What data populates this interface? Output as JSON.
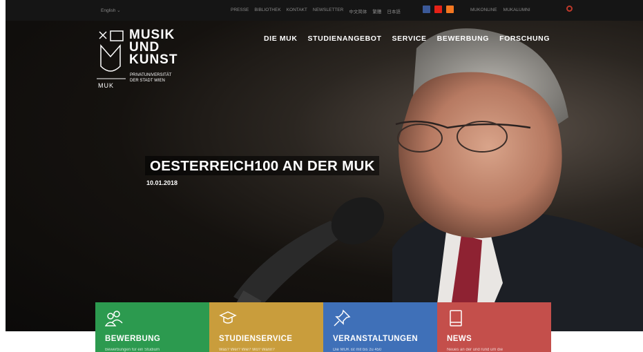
{
  "topbar": {
    "language": "English ⌄",
    "links": [
      "PRESSE",
      "BIBLIOTHEK",
      "KONTAKT",
      "NEWSLETTER",
      "中文简体",
      "繁體",
      "日本語"
    ],
    "social": [
      {
        "icon": "facebook-icon",
        "color": "#3b5998"
      },
      {
        "icon": "youtube-icon",
        "color": "#e62117"
      },
      {
        "icon": "blog-icon",
        "color": "#f47721"
      }
    ],
    "extra_links": [
      "MUKONLINE",
      "MUKALUMNI"
    ]
  },
  "logo": {
    "lines": [
      "MUSIK",
      "UND",
      "KUNST"
    ],
    "subtitle": [
      "PRIVATUNIVERSITÄT",
      "DER STADT WIEN"
    ],
    "abbr": "MUK"
  },
  "nav": [
    "DIE MUK",
    "STUDIENANGEBOT",
    "SERVICE",
    "BEWERBUNG",
    "FORSCHUNG"
  ],
  "hero": {
    "headline": "OESTERREICH100 AN DER MUK",
    "date": "10.01.2018"
  },
  "tiles": [
    {
      "title": "BEWERBUNG",
      "desc": "Bewerbungen für ein Studium",
      "icon": "people-icon",
      "color": "#2c9a4f"
    },
    {
      "title": "STUDIENSERVICE",
      "desc": "Was? Wer? Wie? Wo? Wann?",
      "icon": "graduation-cap-icon",
      "color": "#c99d3c"
    },
    {
      "title": "VERANSTALTUNGEN",
      "desc": "Die MUK ist mit bis zu 450",
      "icon": "pin-icon",
      "color": "#3f70b8"
    },
    {
      "title": "NEWS",
      "desc": "Neues an der und rund um die",
      "icon": "book-icon",
      "color": "#c44f4b"
    }
  ],
  "colors": {
    "topbar": "#151515",
    "search": "#c0392b"
  }
}
